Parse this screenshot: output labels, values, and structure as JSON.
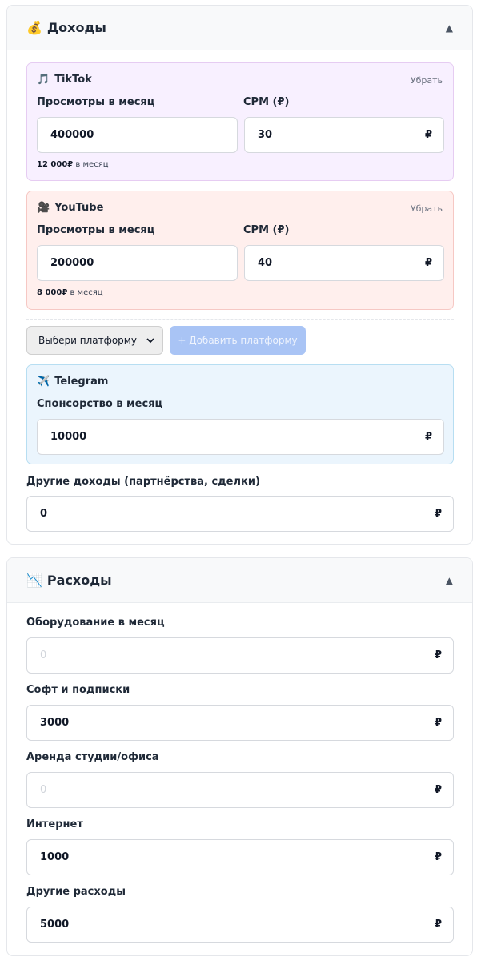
{
  "income": {
    "icon": "money-bag-icon",
    "emoji": "💰",
    "title": "Доходы",
    "toggle": "▲",
    "tiktok": {
      "emoji": "🎵",
      "name": "TikTok",
      "remove": "Убрать",
      "views_label": "Просмотры в месяц",
      "views_value": "400000",
      "cpm_label": "CPM (₽)",
      "cpm_value": "30",
      "currency": "₽",
      "total_value": "12 000₽",
      "total_suffix": "в месяц"
    },
    "youtube": {
      "emoji": "🎥",
      "name": "YouTube",
      "remove": "Убрать",
      "views_label": "Просмотры в месяц",
      "views_value": "200000",
      "cpm_label": "CPM (₽)",
      "cpm_value": "40",
      "currency": "₽",
      "total_value": "8 000₽",
      "total_suffix": "в месяц"
    },
    "platform_select": "Выбери платформу",
    "add_platform": "+ Добавить платформу",
    "telegram": {
      "emoji": "✈️",
      "name": "Telegram",
      "sponsor_label": "Спонсорство в месяц",
      "sponsor_value": "10000",
      "currency": "₽"
    },
    "other_label": "Другие доходы (партнёрства, сделки)",
    "other_value": "0",
    "currency": "₽"
  },
  "expenses": {
    "icon": "chart-down-icon",
    "emoji": "📉",
    "title": "Расходы",
    "toggle": "▲",
    "currency": "₽",
    "items": [
      {
        "label": "Оборудование в месяц",
        "value": "",
        "placeholder": "0"
      },
      {
        "label": "Софт и подписки",
        "value": "3000",
        "placeholder": "0"
      },
      {
        "label": "Аренда студии/офиса",
        "value": "",
        "placeholder": "0"
      },
      {
        "label": "Интернет",
        "value": "1000",
        "placeholder": "0"
      },
      {
        "label": "Другие расходы",
        "value": "5000",
        "placeholder": "0"
      }
    ]
  }
}
